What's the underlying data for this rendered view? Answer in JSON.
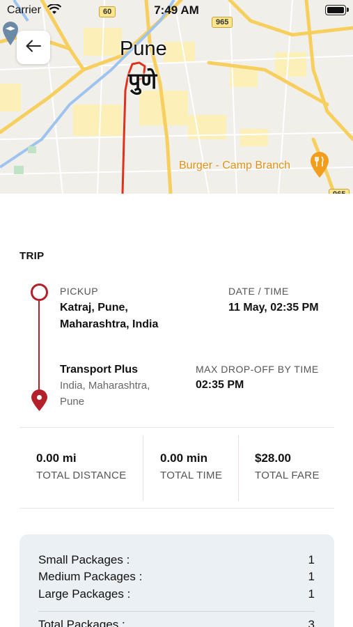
{
  "status_bar": {
    "carrier": "Carrier",
    "time": "7:49 AM"
  },
  "map": {
    "city_name": "Pune",
    "city_name_local": "पुणे",
    "poi_name": "Burger - Camp Branch",
    "highway_shields": [
      "60",
      "965",
      "965"
    ],
    "route_color": "#e0301e",
    "road_color": "#f7cf5e",
    "water_color": "#9dc3ee",
    "urban_area_color": "#fcefb8"
  },
  "back_button": {
    "icon": "arrow-left-icon"
  },
  "trip": {
    "title": "TRIP",
    "accent_color": "#b3202a",
    "pickup": {
      "label": "PICKUP",
      "line1": "Katraj, Pune,",
      "line2": "Maharashtra, India"
    },
    "date_time": {
      "label": "DATE / TIME",
      "value": "11 May, 02:35 PM"
    },
    "dropoff": {
      "name": "Transport Plus",
      "address_line1": "India, Maharashtra,",
      "address_line2": "Pune"
    },
    "max_dropoff": {
      "label": "MAX DROP-OFF BY TIME",
      "value": "02:35 PM"
    }
  },
  "stats": {
    "distance": {
      "value": "0.00 mi",
      "label": "TOTAL DISTANCE"
    },
    "time": {
      "value": "0.00 min",
      "label": "TOTAL TIME"
    },
    "fare": {
      "value": "$28.00",
      "label": "TOTAL FARE"
    }
  },
  "packages": {
    "rows": [
      {
        "label": "Small Packages :",
        "count": "1"
      },
      {
        "label": "Medium Packages :",
        "count": "1"
      },
      {
        "label": "Large Packages :",
        "count": "1"
      }
    ],
    "total": {
      "label": "Total Packages :",
      "count": "3"
    },
    "background": "#eaf0f4"
  }
}
